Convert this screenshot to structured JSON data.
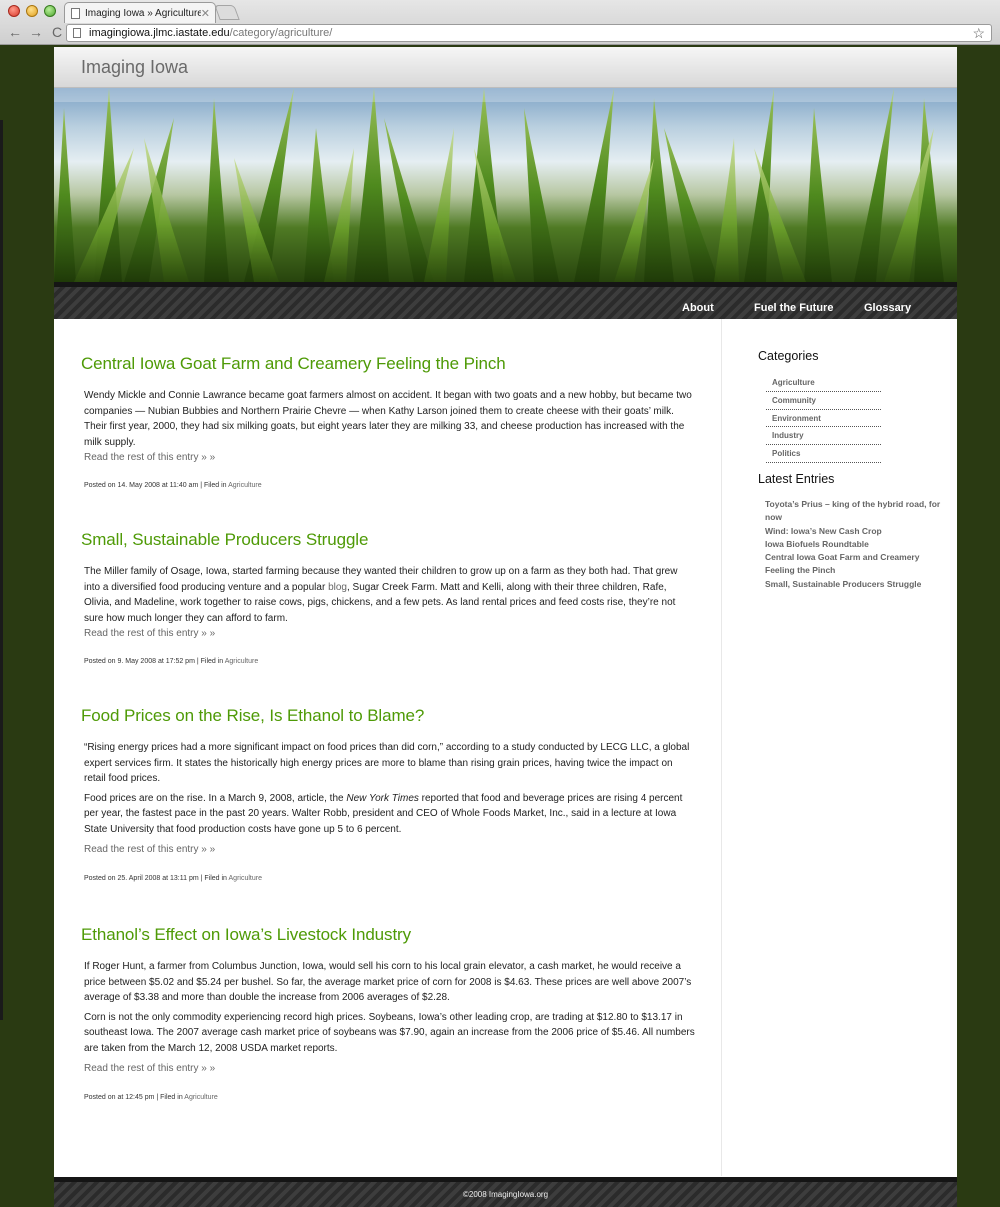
{
  "browser": {
    "tab_title": "Imaging Iowa » Agriculture",
    "tab_close": "✕",
    "url_host": "imagingiowa.jlmc.iastate.edu",
    "url_path": "/category/agriculture/",
    "back": "←",
    "forward": "→",
    "reload": "C",
    "star": "☆"
  },
  "site": {
    "title": "Imaging Iowa",
    "nav": [
      "About",
      "Fuel the Future",
      "Glossary"
    ]
  },
  "posts": [
    {
      "title": "Central Iowa Goat Farm and Creamery Feeling the Pinch",
      "paragraphs": [
        "Wendy Mickle and Connie Lawrance became goat farmers almost on accident. It began with two goats and a new hobby, but became two companies — Nubian Bubbies and Northern Prairie Chevre — when Kathy Larson joined them to create cheese with their goats’ milk. Their first year, 2000, they had six milking goats, but eight years later they are milking 33, and cheese production has increased with the milk supply."
      ],
      "more": "Read the rest of this entry » »",
      "meta": "Posted on 14. May 2008 at 11:40 am | Filed in ",
      "category": "Agriculture"
    },
    {
      "title": "Small, Sustainable Producers Struggle",
      "p1_before": "The Miller family of Osage, Iowa, started farming because they wanted their children to grow up on a farm as they both had. That grew into a diversified food producing venture and a popular ",
      "p1_link": "blog",
      "p1_after": ", Sugar Creek Farm. Matt and Kelli, along with their three children, Rafe, Olivia, and Madeline, work together to raise cows, pigs, chickens, and a few pets. As land rental prices and feed costs rise, they’re not sure how much longer they can afford to farm.",
      "more": "Read the rest of this entry » »",
      "meta": "Posted on 9. May 2008 at 17:52 pm | Filed in ",
      "category": "Agriculture"
    },
    {
      "title": "Food Prices on the Rise, Is Ethanol to Blame?",
      "p1": "“Rising energy prices had a more significant impact on food prices than did corn,” according to a study conducted by LECG LLC, a global expert services firm. It states the historically high energy prices are more to blame than rising grain prices, having twice the impact on retail food prices.",
      "p2_before": "Food prices are on the rise. In a March 9, 2008, article, the ",
      "p2_em": "New York Times",
      "p2_after": " reported that food and beverage prices are rising 4 percent per year, the fastest pace in the past 20 years. Walter Robb, president and CEO of Whole Foods Market, Inc., said in a lecture at Iowa State University that food production costs have gone up 5 to 6 percent.",
      "more": "Read the rest of this entry » »",
      "meta": "Posted on 25. April 2008 at 13:11 pm | Filed in ",
      "category": "Agriculture"
    },
    {
      "title": "Ethanol’s Effect on Iowa’s Livestock Industry",
      "p1": "If Roger Hunt, a farmer from Columbus Junction, Iowa, would sell his corn to his local grain elevator, a cash market, he would receive a price between $5.02 and $5.24 per bushel. So far, the average market price of corn for 2008 is $4.63. These prices are well above 2007’s average of $3.38 and more than double the increase from 2006 averages of $2.28.",
      "p2": "Corn is not the only commodity experiencing record high prices. Soybeans, Iowa’s other leading crop, are trading at $12.80 to $13.17 in southeast Iowa. The 2007 average cash market price of soybeans was $7.90, again an increase from the 2006 price of $5.46. All numbers are taken from the March 12, 2008 USDA market reports.",
      "more": "Read the rest of this entry » »",
      "meta": "Posted on at 12:45 pm | Filed in ",
      "category": "Agriculture"
    }
  ],
  "sidebar": {
    "categories_heading": "Categories",
    "categories": [
      "Agriculture",
      "Community",
      "Environment",
      "Industry",
      "Politics"
    ],
    "latest_heading": "Latest Entries",
    "latest": [
      "Toyota’s Prius – king of the hybrid road, for now",
      "Wind: Iowa’s New Cash Crop",
      "Iowa Biofuels Roundtable",
      "Central Iowa Goat Farm and Creamery Feeling the Pinch",
      "Small, Sustainable Producers Struggle"
    ]
  },
  "footer": {
    "text": "©2008 ImagingIowa.org"
  },
  "colors": {
    "post_title": "#4e9a06",
    "page_background": "#2a3a12"
  }
}
